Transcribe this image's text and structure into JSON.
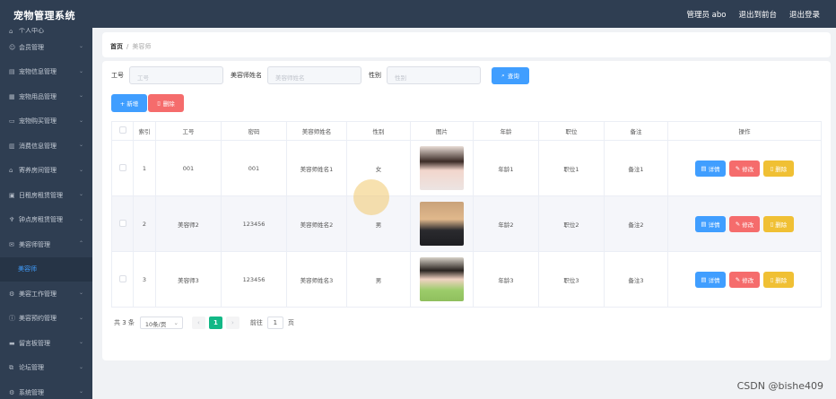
{
  "header": {
    "title": "宠物管理系统",
    "admin": "管理员 abo",
    "back_label": "退出到前台",
    "logout_label": "退出登录"
  },
  "sidebar": {
    "items": [
      {
        "label": "个人中心",
        "icon": "home-icon"
      },
      {
        "label": "会员管理",
        "icon": "user-icon"
      },
      {
        "label": "宠物信息管理",
        "icon": "list-icon"
      },
      {
        "label": "宠物用品管理",
        "icon": "box-icon"
      },
      {
        "label": "宠物购买管理",
        "icon": "cart-icon"
      },
      {
        "label": "消费信息管理",
        "icon": "receipt-icon"
      },
      {
        "label": "寄养房间管理",
        "icon": "house-icon"
      },
      {
        "label": "日租房租赁管理",
        "icon": "calendar-icon"
      },
      {
        "label": "钟点房租赁管理",
        "icon": "clock-icon"
      },
      {
        "label": "美容师管理",
        "icon": "mail-icon"
      }
    ],
    "active_sub": "美容师",
    "items_after": [
      {
        "label": "美容工作管理",
        "icon": "settings-icon"
      },
      {
        "label": "美容预约管理",
        "icon": "info-icon"
      },
      {
        "label": "留言板管理",
        "icon": "message-icon"
      },
      {
        "label": "论坛管理",
        "icon": "forum-icon"
      },
      {
        "label": "系统管理",
        "icon": "gear-icon"
      }
    ]
  },
  "breadcrumb": {
    "home": "首页",
    "separator": "/",
    "current": "美容师"
  },
  "filters": {
    "job_no_label": "工号",
    "job_no_placeholder": "工号",
    "name_label": "美容师姓名",
    "name_placeholder": "美容师姓名",
    "gender_label": "性别",
    "gender_placeholder": "性别",
    "query_label": "查询"
  },
  "actions": {
    "add_label": "+ 新增",
    "delete_label": "删除"
  },
  "table": {
    "headers": [
      "索引",
      "工号",
      "密码",
      "美容师姓名",
      "性别",
      "图片",
      "年龄",
      "职位",
      "备注",
      "操作"
    ],
    "rows": [
      {
        "index": "1",
        "job_no": "001",
        "password": "001",
        "name": "美容师姓名1",
        "gender": "女",
        "age": "年龄1",
        "position": "职位1",
        "note": "备注1"
      },
      {
        "index": "2",
        "job_no": "美容师2",
        "password": "123456",
        "name": "美容师姓名2",
        "gender": "男",
        "age": "年龄2",
        "position": "职位2",
        "note": "备注2"
      },
      {
        "index": "3",
        "job_no": "美容师3",
        "password": "123456",
        "name": "美容师姓名3",
        "gender": "男",
        "age": "年龄3",
        "position": "职位3",
        "note": "备注3"
      }
    ],
    "row_actions": {
      "detail": "详情",
      "edit": "修改",
      "delete": "删除"
    }
  },
  "pagination": {
    "total": "共 3 条",
    "page_size": "10条/页",
    "current": "1",
    "goto_label": "前往",
    "goto_value": "1",
    "page_unit": "页"
  },
  "watermark": "CSDN @bishe409",
  "colors": {
    "primary": "#409eff",
    "danger": "#f56c6c",
    "warning": "#f0c034",
    "success": "#13b886",
    "sidebar_bg": "#2f3e52"
  }
}
